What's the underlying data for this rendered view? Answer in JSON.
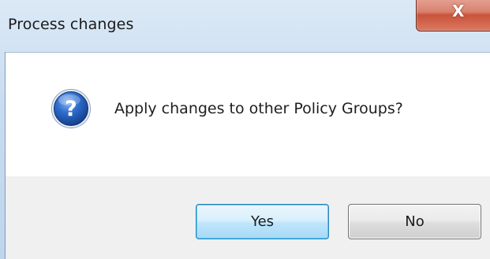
{
  "window": {
    "title": "Process changes"
  },
  "titlebar": {
    "close_icon": "close-icon",
    "close_glyph": "X"
  },
  "dialog": {
    "icon": "question-icon",
    "message": "Apply changes to other Policy Groups?"
  },
  "buttons": {
    "yes_label": "Yes",
    "no_label": "No"
  },
  "colors": {
    "close_button": "#c9533b",
    "default_button_border": "#3c7fb1",
    "question_icon_blue": "#1f5fbf"
  }
}
